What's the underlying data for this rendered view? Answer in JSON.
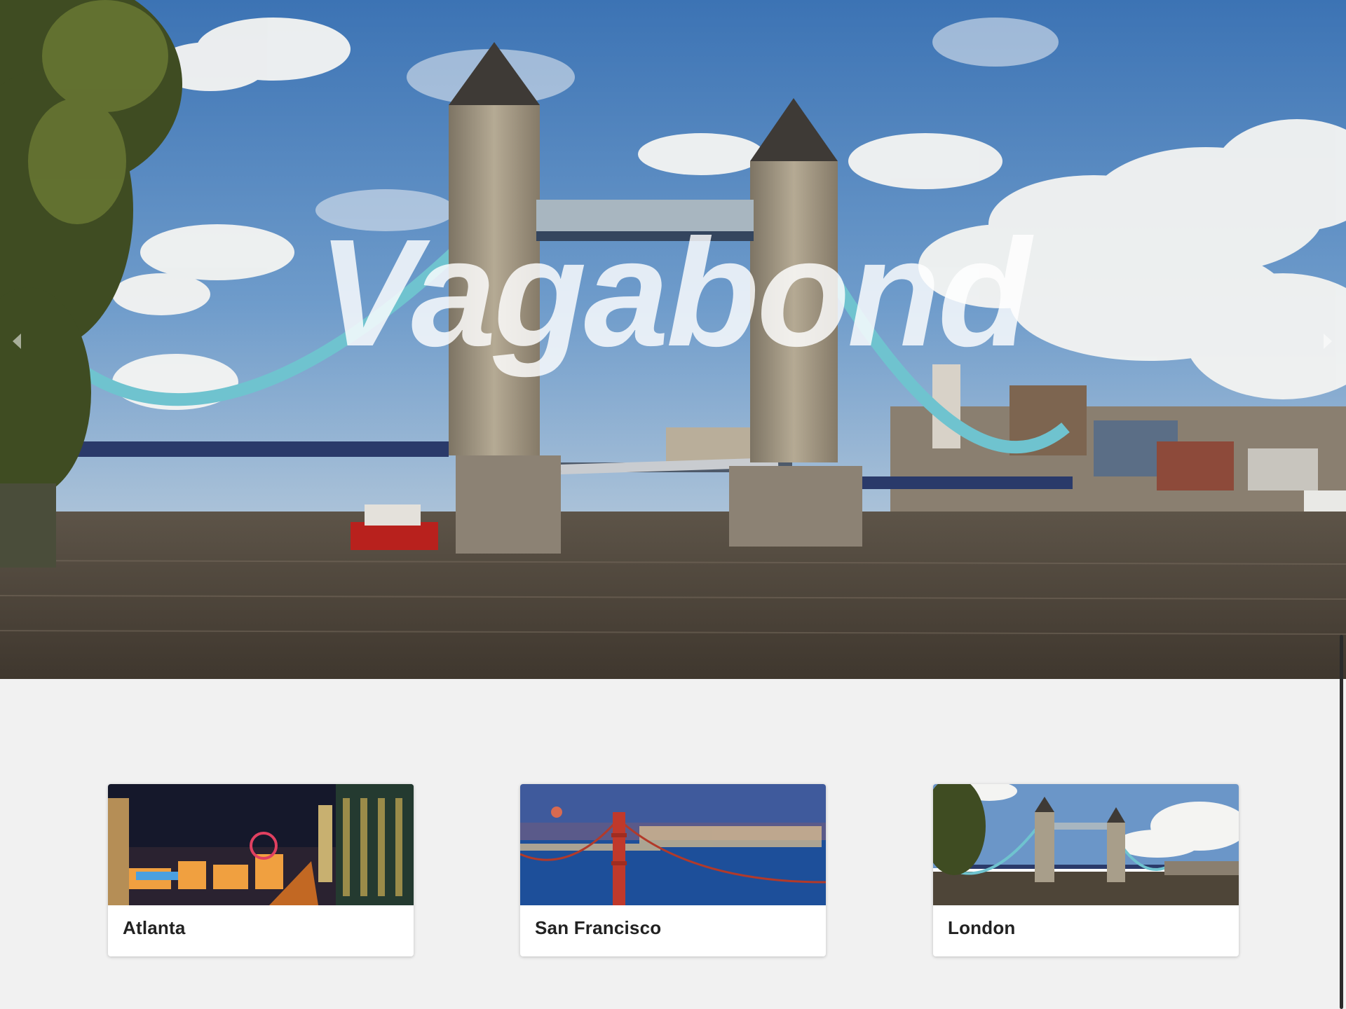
{
  "hero": {
    "title": "Vagabond",
    "prev_icon": "chevron-left-icon",
    "next_icon": "chevron-right-icon"
  },
  "cities": [
    {
      "label": "Atlanta"
    },
    {
      "label": "San Francisco"
    },
    {
      "label": "London"
    }
  ],
  "colors": {
    "page_background": "#f1f1f1",
    "card_background": "#ffffff",
    "card_text": "#222222",
    "title_overlay": "rgba(255,255,255,0.82)"
  }
}
